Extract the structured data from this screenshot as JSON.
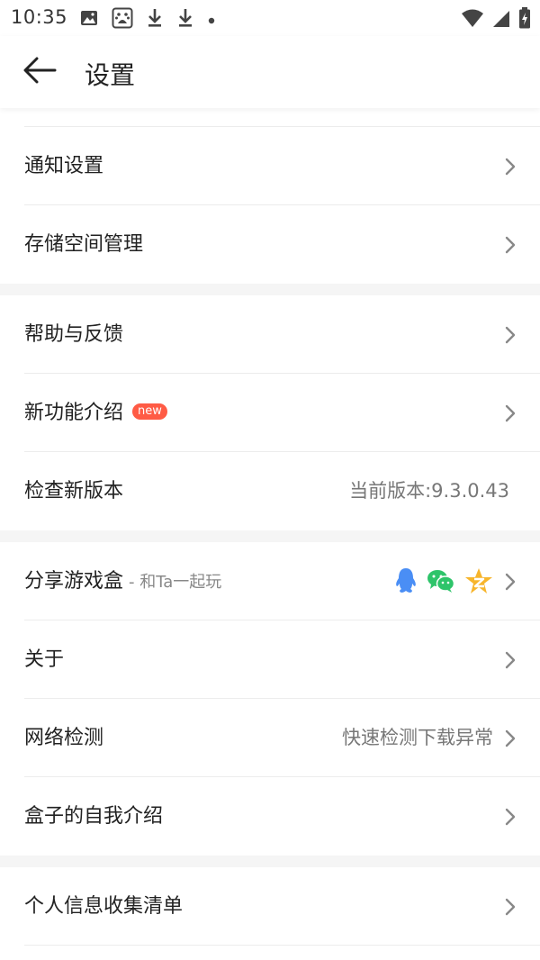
{
  "status_bar": {
    "time": "10:35",
    "left_icons": [
      "image-icon",
      "baidu-paw-icon",
      "download-icon",
      "download-icon",
      "dot-icon"
    ],
    "right_icons": [
      "wifi-icon",
      "signal-icon",
      "battery-charging-icon"
    ]
  },
  "header": {
    "title": "设置",
    "back_icon": "arrow-left-icon"
  },
  "sections": [
    {
      "items": [
        {
          "label": "通知设置"
        },
        {
          "label": "存储空间管理"
        }
      ]
    },
    {
      "items": [
        {
          "label": "帮助与反馈"
        },
        {
          "label": "新功能介绍",
          "badge": "new"
        },
        {
          "label": "检查新版本",
          "value": "当前版本:9.3.0.43"
        }
      ]
    },
    {
      "items": [
        {
          "label": "分享游戏盒",
          "subtext": "- 和Ta一起玩",
          "share_icons": [
            "qq-icon",
            "wechat-icon",
            "qzone-icon"
          ]
        },
        {
          "label": "关于"
        },
        {
          "label": "网络检测",
          "value": "快速检测下载异常"
        },
        {
          "label": "盒子的自我介绍"
        }
      ]
    },
    {
      "items": [
        {
          "label": "个人信息收集清单"
        }
      ]
    }
  ],
  "colors": {
    "badge_bg": "#ff5b45",
    "section_gap": "#f5f5f5",
    "qq_blue": "#4a8ef5",
    "wechat_green": "#2ec46a",
    "qzone_yellow": "#f7b52c"
  }
}
